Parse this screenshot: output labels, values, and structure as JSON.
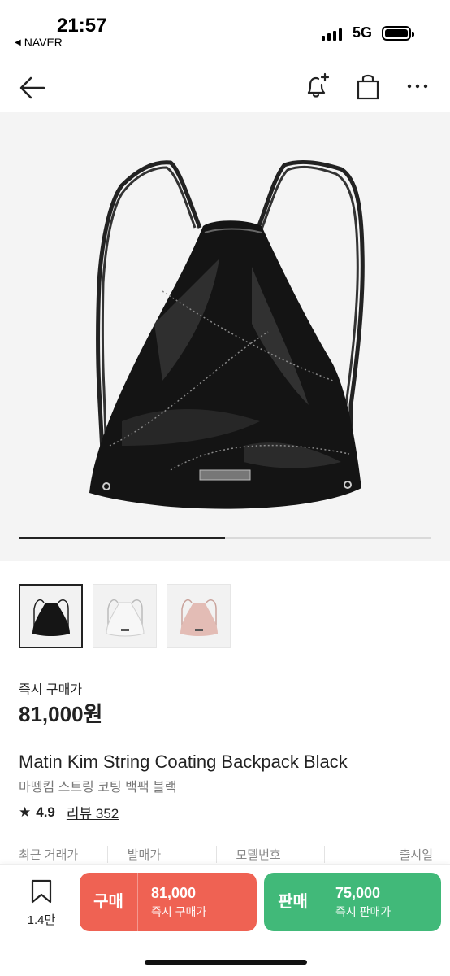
{
  "status_bar": {
    "time": "21:57",
    "back_app": "NAVER",
    "network": "5G"
  },
  "nav": {
    "icons": [
      "back-arrow-icon",
      "bell-plus-icon",
      "shopping-bag-icon",
      "more-icon"
    ]
  },
  "gallery": {
    "position_fraction": 0.5
  },
  "product": {
    "buy_label": "즉시 구매가",
    "price": "81,000원",
    "name_en": "Matin Kim String Coating Backpack Black",
    "name_ko": "마뗑킴 스트링 코팅 백팩 블랙",
    "rating": "4.9",
    "review_label": "리뷰 352"
  },
  "info_headers": [
    "최근 거래가",
    "발매가",
    "모델번호",
    "출시일"
  ],
  "bottom_bar": {
    "wish_count": "1.4만",
    "buy": {
      "label": "구매",
      "amount": "81,000",
      "desc": "즉시 구매가",
      "color": "#ef6253"
    },
    "sell": {
      "label": "판매",
      "amount": "75,000",
      "desc": "즉시 판매가",
      "color": "#41b979"
    }
  }
}
